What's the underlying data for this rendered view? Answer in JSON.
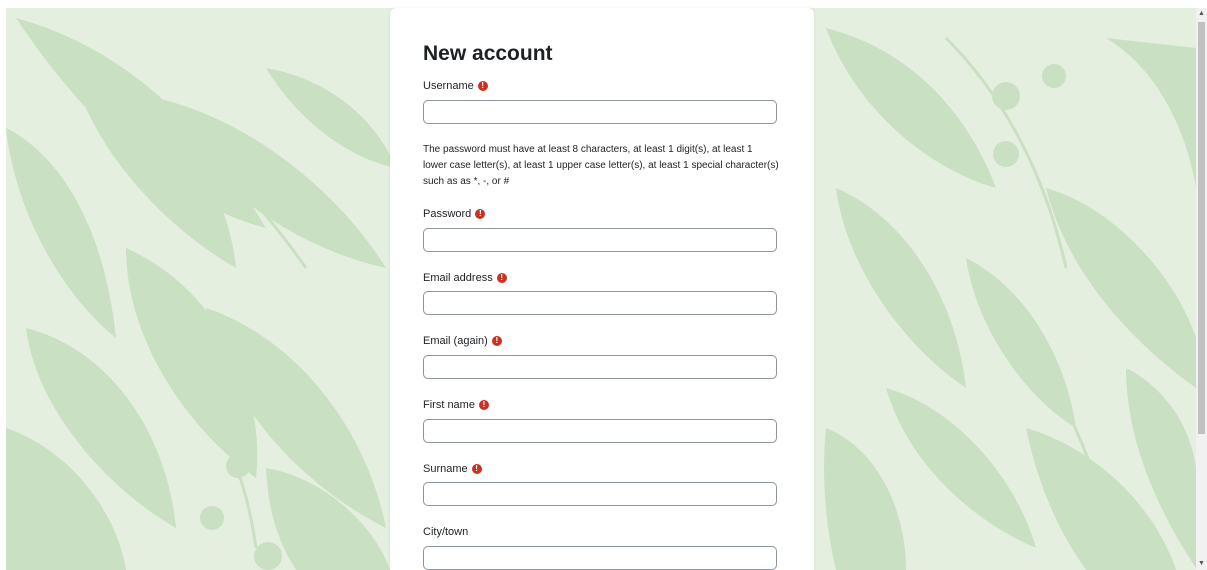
{
  "form": {
    "title": "New account",
    "password_policy": "The password must have at least 8 characters, at least 1 digit(s), at least 1 lower case letter(s), at least 1 upper case letter(s), at least 1 special character(s) such as as *, -, or #",
    "required_icon_glyph": "!",
    "fields": {
      "username": {
        "label": "Username",
        "value": ""
      },
      "password": {
        "label": "Password",
        "value": ""
      },
      "email": {
        "label": "Email address",
        "value": ""
      },
      "email2": {
        "label": "Email (again)",
        "value": ""
      },
      "firstname": {
        "label": "First name",
        "value": ""
      },
      "surname": {
        "label": "Surname",
        "value": ""
      },
      "city": {
        "label": "City/town",
        "value": ""
      }
    }
  },
  "scrollbar": {
    "up": "▲",
    "down": "▼"
  },
  "colors": {
    "background": "#e4efe0",
    "leaf": "#c7e0c0",
    "required": "#ca3120"
  },
  "icons": [
    "exclamation-circle-icon"
  ]
}
